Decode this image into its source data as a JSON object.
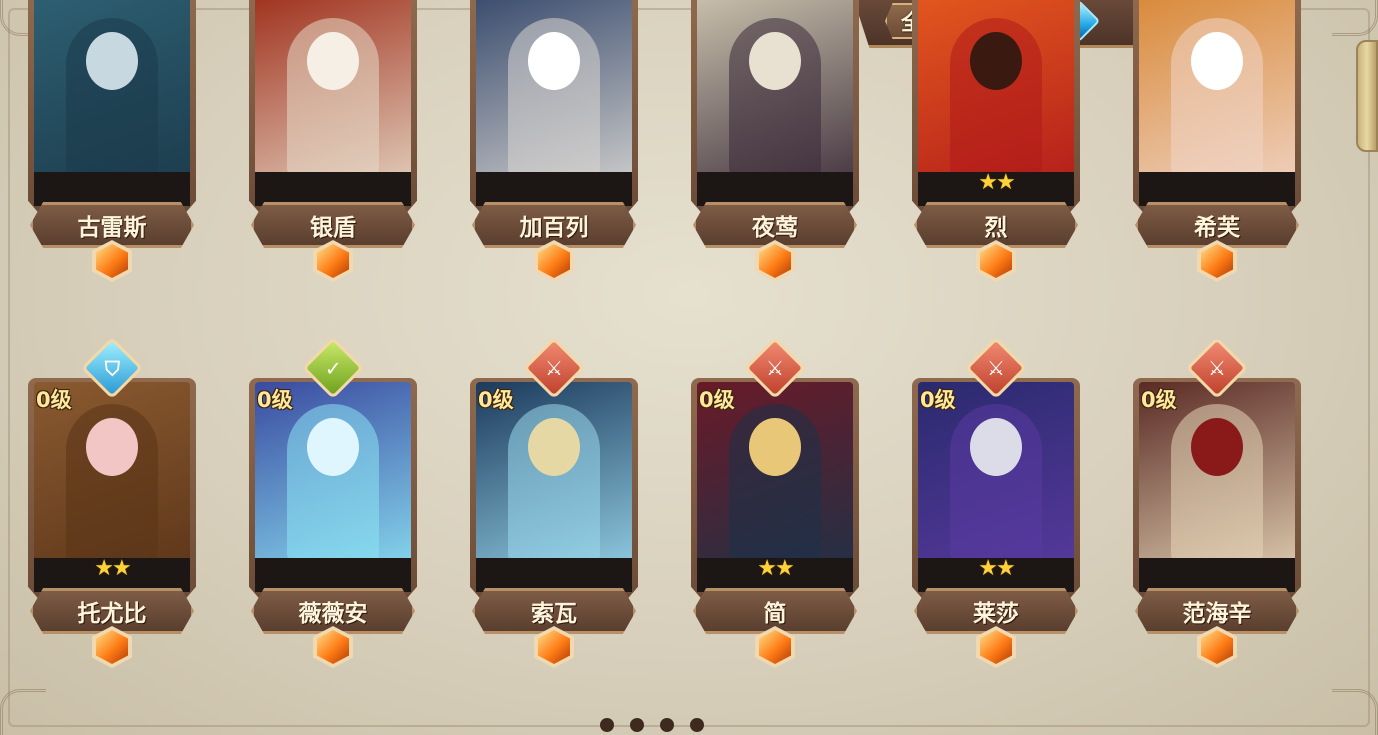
{
  "filter": {
    "all_label": "全部",
    "gems": [
      {
        "name": "white-gem-filter",
        "type": "white"
      },
      {
        "name": "blue-gem-filter",
        "type": "blue"
      },
      {
        "name": "purple-gem-filter",
        "type": "purple"
      },
      {
        "name": "orange-gem-filter",
        "type": "orange",
        "active": true
      }
    ]
  },
  "heroes_row1": [
    {
      "name": "古雷斯",
      "stars": "",
      "colors": [
        "#2d5f72",
        "#1b3a4a",
        "#c8d8e0"
      ]
    },
    {
      "name": "银盾",
      "stars": "",
      "colors": [
        "#a0321e",
        "#e6d8c6",
        "#f6efe6"
      ]
    },
    {
      "name": "加百列",
      "stars": "",
      "colors": [
        "#3a4c6e",
        "#d8d6d2",
        "#ffffff"
      ]
    },
    {
      "name": "夜莺",
      "stars": "",
      "colors": [
        "#c8c0ac",
        "#3a2a38",
        "#e8e0d0"
      ]
    },
    {
      "name": "烈",
      "stars": "★★",
      "colors": [
        "#e2571e",
        "#b01a1a",
        "#3a1a10"
      ]
    },
    {
      "name": "希芙",
      "stars": "",
      "colors": [
        "#d98a3a",
        "#f0d6c8",
        "#ffffff"
      ]
    }
  ],
  "heroes_row2": [
    {
      "name": "托尤比",
      "level": "0级",
      "stars": "★★",
      "badge": "blue",
      "badge_icon": "shield-icon",
      "colors": [
        "#8a5a30",
        "#5a3418",
        "#f2c6c4"
      ]
    },
    {
      "name": "薇薇安",
      "level": "0级",
      "stars": "",
      "badge": "green",
      "badge_icon": "heart-icon",
      "colors": [
        "#3a4aa0",
        "#8de4f4",
        "#e0f6ff"
      ]
    },
    {
      "name": "索瓦",
      "level": "0级",
      "stars": "",
      "badge": "red",
      "badge_icon": "sword-icon",
      "colors": [
        "#1c3a5c",
        "#9ad8ec",
        "#e6d8a4"
      ]
    },
    {
      "name": "简",
      "level": "0级",
      "stars": "★★",
      "badge": "red",
      "badge_icon": "sword-icon",
      "colors": [
        "#6a1a28",
        "#1c3248",
        "#e8c878"
      ]
    },
    {
      "name": "莱莎",
      "level": "0级",
      "stars": "★★",
      "badge": "red",
      "badge_icon": "sword-icon",
      "colors": [
        "#2a2a6e",
        "#5a3aa0",
        "#dcdce8"
      ]
    },
    {
      "name": "范海辛",
      "level": "0级",
      "stars": "",
      "badge": "red",
      "badge_icon": "sword-icon",
      "colors": [
        "#5a2a24",
        "#e6d6b8",
        "#8a1a1a"
      ]
    }
  ]
}
